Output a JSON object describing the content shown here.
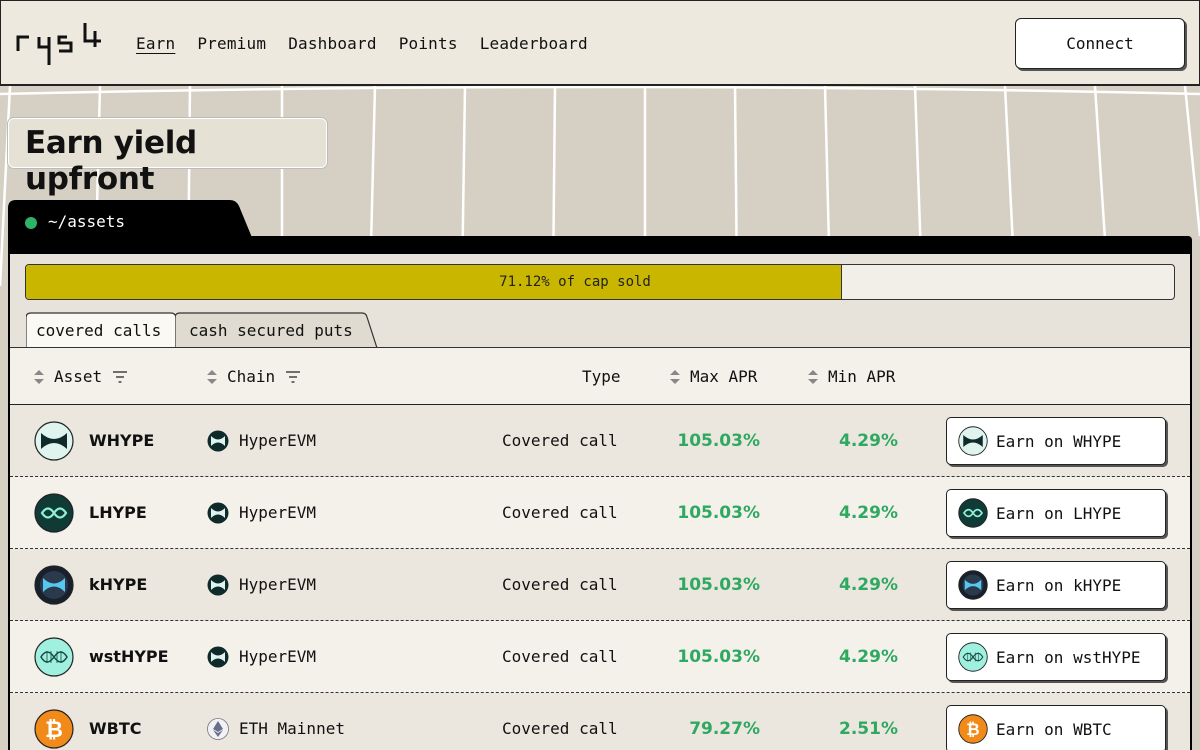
{
  "header": {
    "nav": [
      "Earn",
      "Premium",
      "Dashboard",
      "Points",
      "Leaderboard"
    ],
    "active_nav": "Earn",
    "connect_label": "Connect"
  },
  "hero": {
    "title": "Earn yield upfront"
  },
  "panel": {
    "path": "~/assets",
    "progress_label": "71.12% of cap sold",
    "progress_fraction": 0.7112,
    "tabs": [
      "covered calls",
      "cash secured puts"
    ],
    "active_tab": "covered calls"
  },
  "table": {
    "headers": {
      "asset": "Asset",
      "chain": "Chain",
      "type": "Type",
      "max_apr": "Max APR",
      "min_apr": "Min APR"
    },
    "rows": [
      {
        "asset": "WHYPE",
        "icon": "whype-icon",
        "chain": "HyperEVM",
        "chain_icon": "hyperevm-icon",
        "type": "Covered call",
        "max_apr": "105.03%",
        "min_apr": "4.29%",
        "button": "Earn on WHYPE"
      },
      {
        "asset": "LHYPE",
        "icon": "lhype-icon",
        "chain": "HyperEVM",
        "chain_icon": "hyperevm-icon",
        "type": "Covered call",
        "max_apr": "105.03%",
        "min_apr": "4.29%",
        "button": "Earn on LHYPE"
      },
      {
        "asset": "kHYPE",
        "icon": "khype-icon",
        "chain": "HyperEVM",
        "chain_icon": "hyperevm-icon",
        "type": "Covered call",
        "max_apr": "105.03%",
        "min_apr": "4.29%",
        "button": "Earn on kHYPE"
      },
      {
        "asset": "wstHYPE",
        "icon": "wsthype-icon",
        "chain": "HyperEVM",
        "chain_icon": "hyperevm-icon",
        "type": "Covered call",
        "max_apr": "105.03%",
        "min_apr": "4.29%",
        "button": "Earn on wstHYPE"
      },
      {
        "asset": "WBTC",
        "icon": "bitcoin-icon",
        "chain": "ETH Mainnet",
        "chain_icon": "ethereum-icon",
        "type": "Covered call",
        "max_apr": "79.27%",
        "min_apr": "2.51%",
        "button": "Earn on WBTC"
      }
    ]
  },
  "colors": {
    "accent_green": "#2fa862",
    "progress_fill": "#c8b600",
    "status_dot": "#2fb36a"
  }
}
